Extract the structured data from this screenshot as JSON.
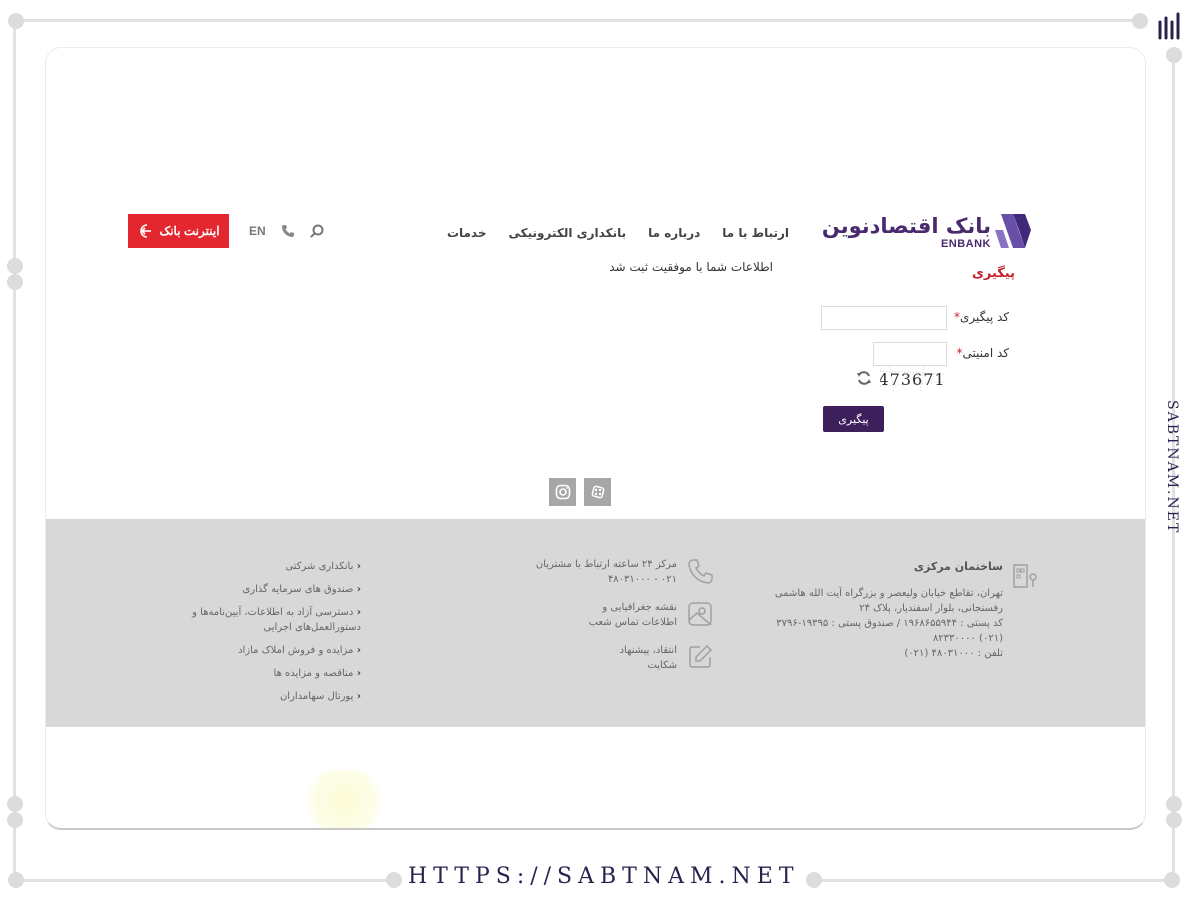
{
  "header": {
    "logo_fa": "بانک اقتصادنوین",
    "logo_en": "ENBANK",
    "nav": [
      "خدمات",
      "بانکداری الکترونیکی",
      "درباره ما",
      "ارتباط با ما"
    ],
    "lang": "EN",
    "internet_bank_label": "اینترنت بانک"
  },
  "main": {
    "success_message": "اطلاعات شما با موفقیت ثبت شد",
    "section_title": "پیگیری",
    "tracking_label": "کد پیگیری",
    "tracking_value": "",
    "security_label": "کد امنیتی",
    "security_value": "",
    "captcha_text": "473671",
    "submit_label": "پیگیری"
  },
  "footer": {
    "hq_title": "ساختمان مرکزی",
    "hq_address": "تهران، تقاطع خیابان ولیعصر و بزرگراه آیت الله هاشمی رفسنجانی، بلوار اسفندیار، پلاک ۲۴",
    "hq_postal": "کد پستی : ۱۹۶۸۶۵۵۹۴۴ / صندوق پستی : ۱۹۳۹۵-۳۷۹۶",
    "hq_phone1": "(۰۲۱) ۸۲۳۳۰۰۰۰",
    "hq_phone2": "تلفن : ۴۸۰۳۱۰۰۰ (۰۲۱)",
    "contact_center_label": "مرکز ۲۴ ساعته ارتباط با مشتریان",
    "contact_center_phone": "۰۲۱ - ۴۸۰۳۱۰۰۰",
    "map_label_1": "نقشه جغرافیایی و",
    "map_label_2": "اطلاعات تماس شعب",
    "feedback_label_1": "انتقاد، پیشنهاد",
    "feedback_label_2": "شکایت",
    "links": [
      "بانکداری شرکتی",
      "صندوق های سرمایه گذاری",
      "دسترسی آزاد به اطلاعات، آیین‌نامه‌ها و دستورالعمل‌های اجرایی",
      "مزایده و فروش املاک مازاد",
      "مناقصه و مزایده ها",
      "پورتال سهامداران"
    ]
  },
  "watermark": {
    "url": "HTTPS://SABTNAM.NET",
    "side": "SABTNAM.NET"
  },
  "colors": {
    "brand_purple": "#4a2a6e",
    "accent_red": "#e4262f",
    "submit_purple": "#3d1f5c",
    "footer_gray": "#d8d8d8"
  }
}
